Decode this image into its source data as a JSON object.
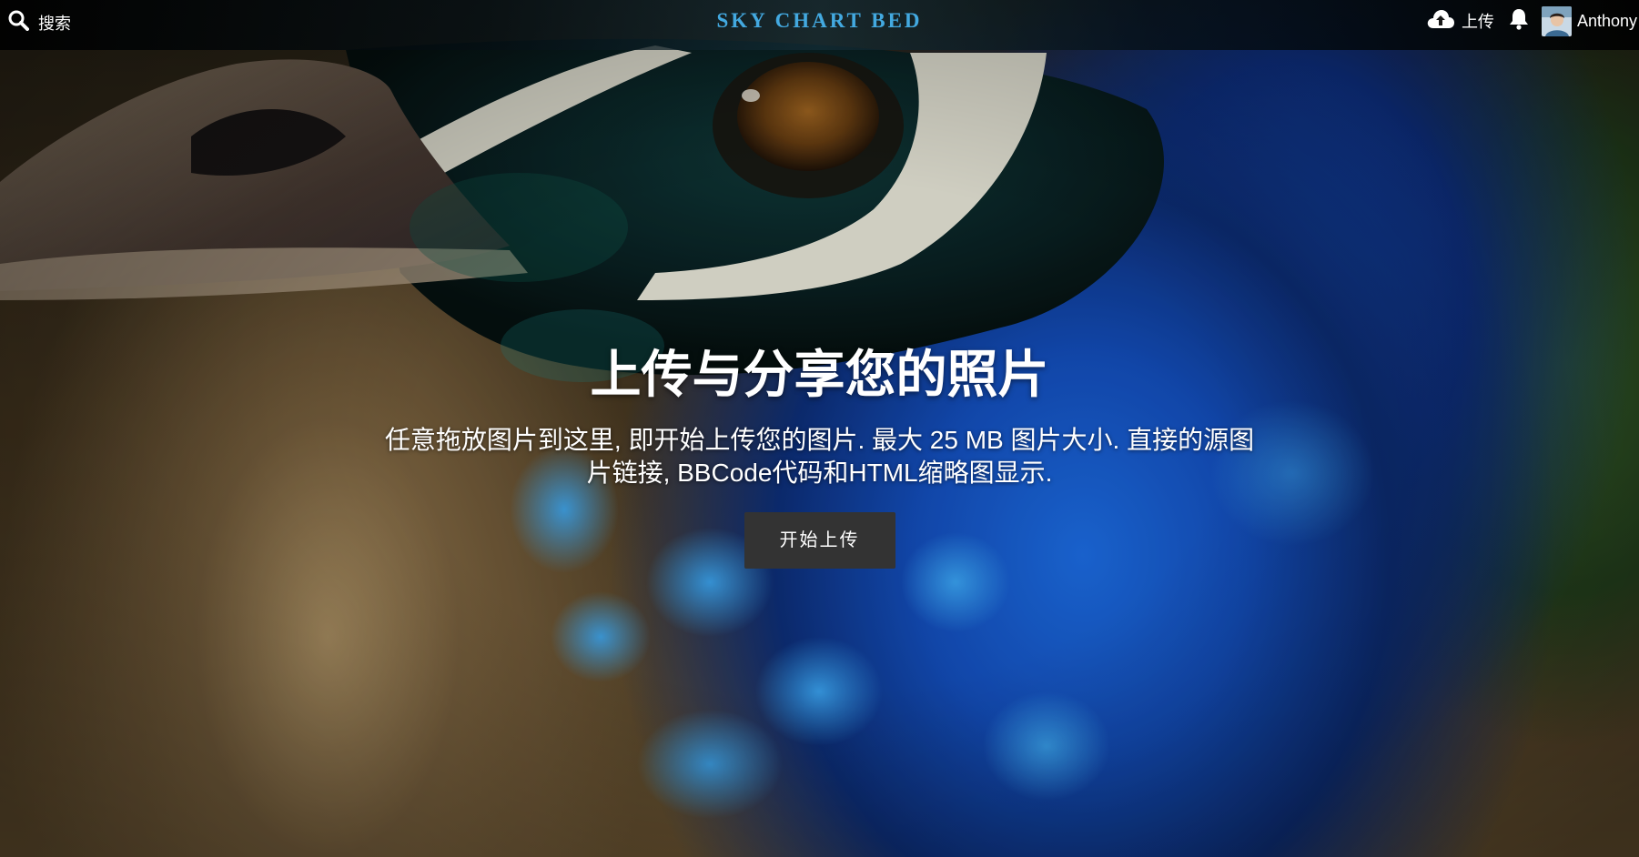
{
  "header": {
    "search_label": "搜索",
    "brand": "SKY CHART BED",
    "upload_label": "上传",
    "username": "Anthony"
  },
  "hero": {
    "title": "上传与分享您的照片",
    "description": "任意拖放图片到这里, 即开始上传您的图片. 最大 25 MB 图片大小. 直接的源图片链接, BBCode代码和HTML缩略图显示.",
    "start_button": "开始上传"
  },
  "colors": {
    "brand": "#43a9e0",
    "button_bg": "#333333",
    "text": "#ffffff"
  },
  "icons": {
    "search": "search-icon",
    "upload": "cloud-upload-icon",
    "notifications": "bell-icon",
    "avatar": "avatar"
  }
}
